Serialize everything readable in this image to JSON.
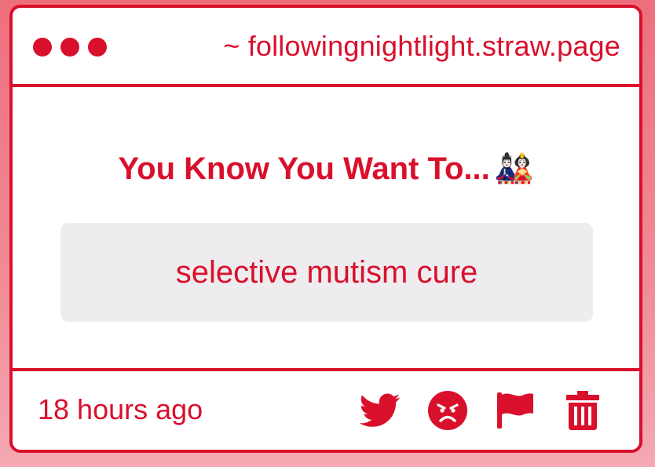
{
  "window": {
    "url": "~ followingnightlight.straw.page",
    "controls": [
      "dot",
      "dot",
      "dot"
    ]
  },
  "poll": {
    "title": "You Know You Want To...",
    "title_emoji": "🎎",
    "answer": "selective mutism cure"
  },
  "footer": {
    "timestamp": "18 hours ago",
    "actions": [
      {
        "name": "twitter-share",
        "icon": "twitter-bird-icon"
      },
      {
        "name": "angry-reaction",
        "icon": "angry-face-icon"
      },
      {
        "name": "report",
        "icon": "flag-icon"
      },
      {
        "name": "delete",
        "icon": "trash-icon"
      }
    ]
  },
  "colors": {
    "accent": "#d9102c",
    "background_top": "#ee6f7c",
    "background_bottom": "#f4a9b2",
    "card": "#ffffff",
    "answer_box": "#eeecee"
  }
}
